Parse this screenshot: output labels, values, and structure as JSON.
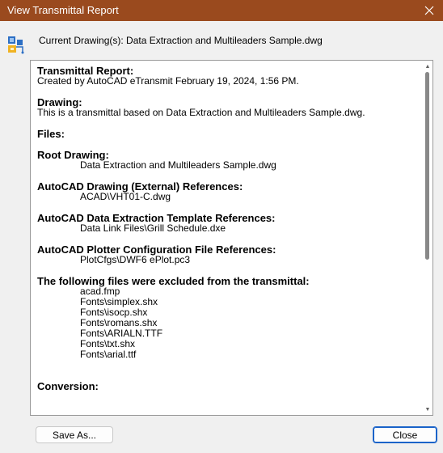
{
  "window": {
    "title": "View Transmittal Report",
    "close_icon": "close-icon"
  },
  "header": {
    "current_drawing": "Current Drawing(s): Data Extraction and Multileaders Sample.dwg",
    "icon": "transmittal-icon"
  },
  "report": {
    "transmittal_heading": "Transmittal Report:",
    "created_by": "Created by AutoCAD eTransmit February 19, 2024, 1:56 PM.",
    "drawing_heading": "Drawing:",
    "drawing_text": "This is a transmittal based on Data Extraction and Multileaders Sample.dwg.",
    "files_heading": "Files:",
    "root_heading": "Root Drawing:",
    "root_file": "Data Extraction and Multileaders Sample.dwg",
    "xref_heading": "AutoCAD Drawing (External) References:",
    "xref_file": "ACAD\\VHT01-C.dwg",
    "dxe_heading": "AutoCAD Data Extraction Template References:",
    "dxe_file": "Data Link Files\\Grill Schedule.dxe",
    "plotter_heading": "AutoCAD Plotter Configuration File References:",
    "plotter_file": "PlotCfgs\\DWF6 ePlot.pc3",
    "excluded_heading": "The following files were excluded from the transmittal:",
    "excluded_files": [
      "acad.fmp",
      "Fonts\\simplex.shx",
      "Fonts\\isocp.shx",
      "Fonts\\romans.shx",
      "Fonts\\ARIALN.TTF",
      "Fonts\\txt.shx",
      "Fonts\\arial.ttf"
    ],
    "conversion_heading": "Conversion:"
  },
  "buttons": {
    "save_as": "Save As...",
    "close": "Close"
  },
  "colors": {
    "titlebar": "#9a4a1e",
    "accent_border": "#1a63c9"
  }
}
